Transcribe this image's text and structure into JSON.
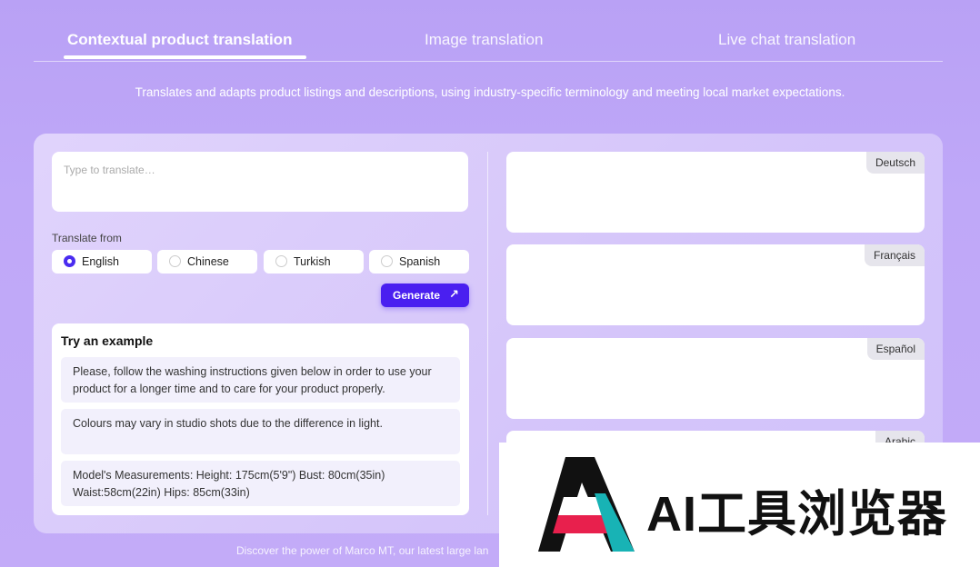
{
  "tabs": [
    {
      "label": "Contextual product translation",
      "active": true
    },
    {
      "label": "Image translation",
      "active": false
    },
    {
      "label": "Live chat translation",
      "active": false
    }
  ],
  "subtitle": "Translates and adapts product listings and descriptions, using industry-specific terminology and meeting local market expectations.",
  "input": {
    "placeholder": "Type to translate…",
    "value": ""
  },
  "translate_from": {
    "label": "Translate from",
    "options": [
      "English",
      "Chinese",
      "Turkish",
      "Spanish"
    ],
    "selected": "English"
  },
  "generate_label": "Generate",
  "examples": {
    "heading": "Try an example",
    "items": [
      "Please, follow the washing instructions given below in order to use your product for a longer time and to care for your product properly.",
      "Colours may vary in studio shots due to the difference in light.",
      "Model's Measurements: Height: 175cm(5'9\") Bust: 80cm(35in) Waist:58cm(22in) Hips: 85cm(33in)"
    ]
  },
  "outputs": [
    "Deutsch",
    "Français",
    "Español",
    "Arabic"
  ],
  "footer": "Discover the power of Marco MT, our latest large lan",
  "watermark": {
    "text": "AI工具浏览器"
  },
  "colors": {
    "accent": "#4a1ff0",
    "background": "#bfa8f8"
  }
}
